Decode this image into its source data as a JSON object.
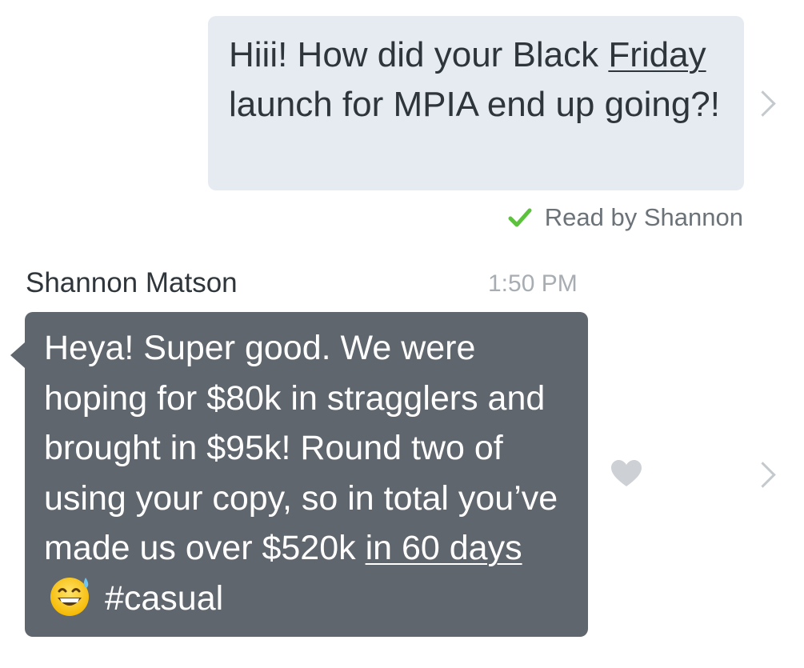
{
  "outgoing": {
    "text_1": "Hiii! How did your Black ",
    "text_underlined": "Friday",
    "text_2": " launch for MPIA end up going?!",
    "read_receipt": "Read by Shannon"
  },
  "incoming": {
    "sender": "Shannon Matson",
    "time": "1:50 PM",
    "text_1": "Heya! Super good. We were hoping for $80k in stragglers and brought in $95k! Round two of using your copy, so in total you’ve made us over $520k ",
    "text_underlined": "in 60 days",
    "emoji": "grinning-face-with-sweat-icon",
    "text_2": " #casual"
  },
  "colors": {
    "outgoing_bubble": "#e6ebf2",
    "incoming_bubble": "#5f666d",
    "read_check": "#5cc23e",
    "muted_text": "#a7adb2"
  }
}
